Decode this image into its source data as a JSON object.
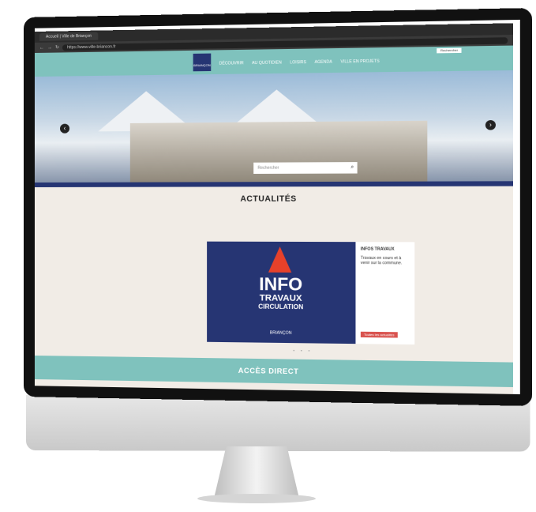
{
  "browser": {
    "tab_title": "Accueil | Ville de Briançon",
    "url": "https://www.ville-briancon.fr"
  },
  "header": {
    "logo_text": "BRIANÇON",
    "nav_items": [
      "DÉCOUVRIR",
      "AU QUOTIDIEN",
      "LOISIRS",
      "AGENDA",
      "VILLE EN PROJETS"
    ],
    "top_search_placeholder": "Rechercher"
  },
  "hero": {
    "search_placeholder": "Rechercher",
    "search_icon": "search-icon",
    "prev_arrow": "‹",
    "next_arrow": "›"
  },
  "news": {
    "section_title": "ACTUALITÉS",
    "card_image_info": "INFO",
    "card_image_travaux": "TRAVAUX",
    "card_image_circulation": "CIRCULATION",
    "card_image_brand": "BRIANÇON",
    "card_title": "INFOS TRAVAUX",
    "card_text": "Travaux en cours et à venir sur la commune.",
    "card_button": "Toutes les actualités",
    "pager": "• • •"
  },
  "access": {
    "title": "ACCÈS DIRECT"
  },
  "colors": {
    "teal": "#7fc2bd",
    "navy": "#263573",
    "cone_red": "#e7412a"
  }
}
